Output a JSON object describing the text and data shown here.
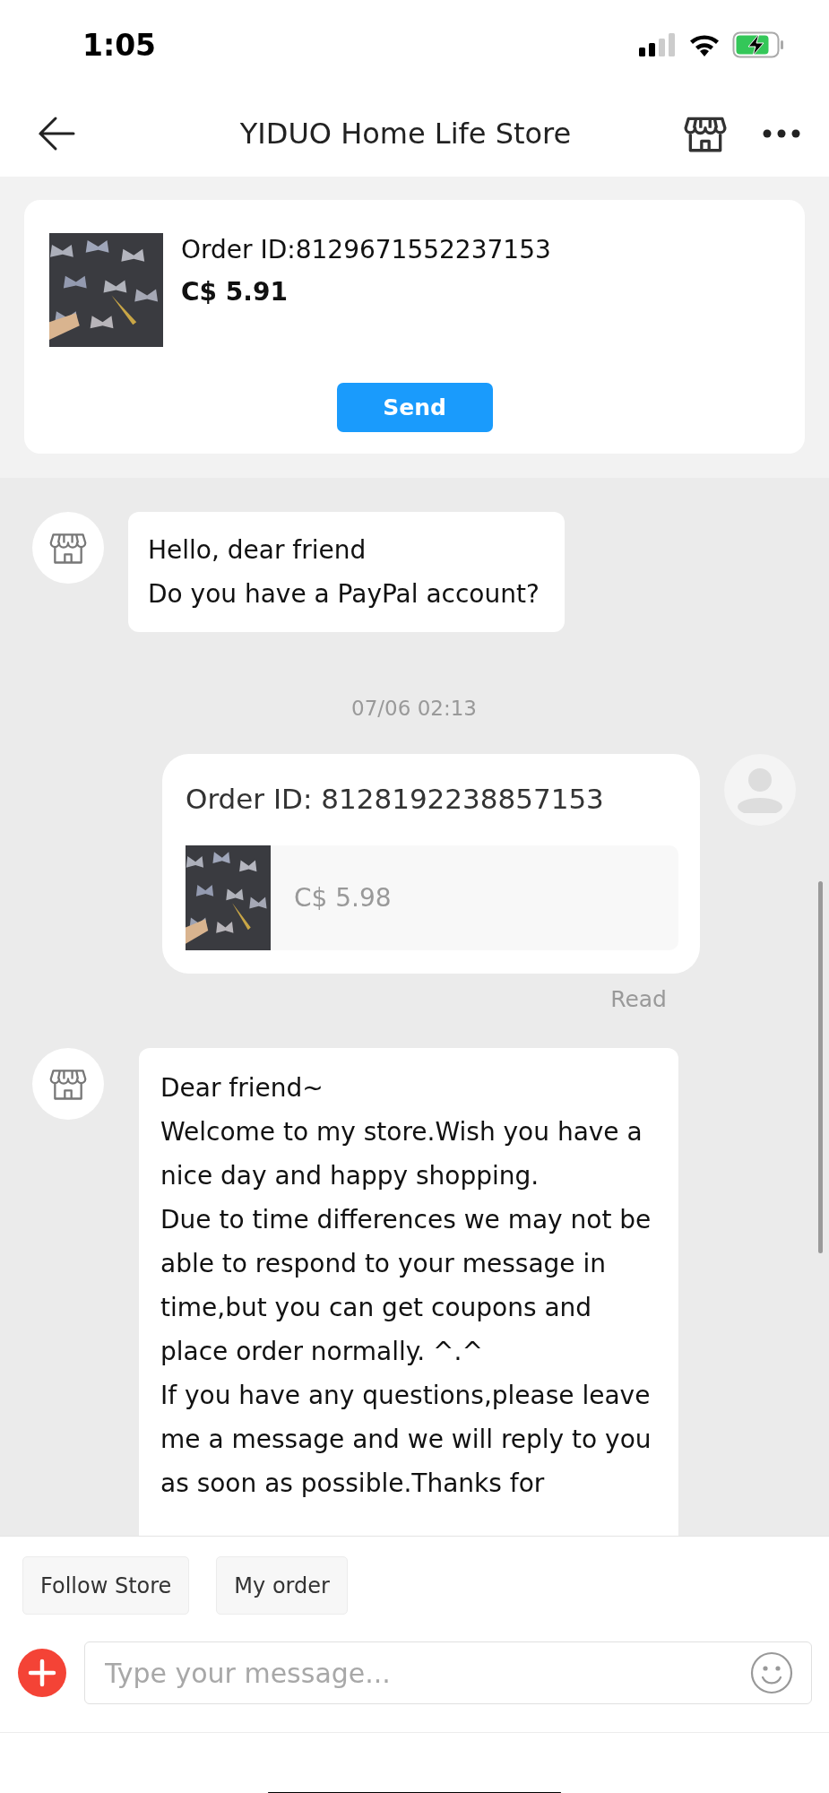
{
  "status_bar": {
    "time": "1:05"
  },
  "header": {
    "title": "YIDUO Home Life Store"
  },
  "order_card": {
    "order_id": "Order ID:8129671552237153",
    "price": "C$ 5.91",
    "button": "Send"
  },
  "messages": [
    {
      "kind": "text",
      "outgoing": false,
      "paragraphs": [
        "Hello, dear friend",
        "Do you have a PayPal account?"
      ]
    },
    {
      "kind": "time",
      "text": "07/06 02:13"
    },
    {
      "kind": "order",
      "outgoing": true,
      "order_id": "Order ID: 8128192238857153",
      "price": "C$ 5.98",
      "status": "Read"
    },
    {
      "kind": "text",
      "outgoing": false,
      "paragraphs": [
        "Dear friend~",
        "Welcome to my store.Wish you have a nice day and happy shopping.",
        "Due to time differences we may not be able to respond to your message in time,but you can get coupons and place order normally. ^.^",
        "If you have any questions,please leave me a message and we will reply to you as soon as possible.Thanks for"
      ]
    }
  ],
  "quick_actions": [
    "Follow Store",
    "My order"
  ],
  "composer": {
    "placeholder": "Type your message..."
  }
}
